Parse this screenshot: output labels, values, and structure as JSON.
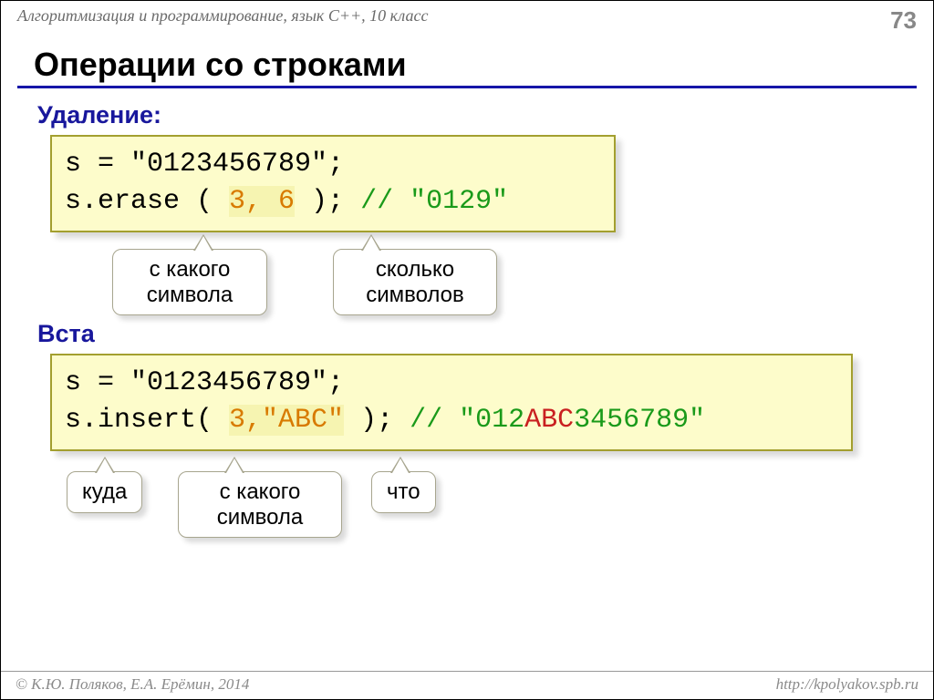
{
  "header": {
    "breadcrumb": "Алгоритмизация и программирование, язык C++, 10 класс",
    "page": "73"
  },
  "title": "Операции со строками",
  "section1": "Удаление:",
  "code1": {
    "l1": "s = \"0123456789\";",
    "l2a": "s.erase ( ",
    "l2b": "3, 6",
    "l2c": " ); ",
    "l2d": "// \"0129\""
  },
  "callouts1": {
    "from": "с какого символа",
    "count": "сколько символов"
  },
  "section2": "Вста",
  "code2": {
    "l1": "s = \"0123456789\";",
    "l2a": "s.insert( ",
    "l2b": "3,\"ABC\"",
    "l2c": " ); ",
    "l2d_a": "// \"012",
    "l2d_b": "ABC",
    "l2d_c": "3456789\""
  },
  "callouts2": {
    "where": "куда",
    "from": "с какого символа",
    "what": "что"
  },
  "footer": {
    "left": "© К.Ю. Поляков, Е.А. Ерёмин, 2014",
    "right": "http://kpolyakov.spb.ru"
  }
}
